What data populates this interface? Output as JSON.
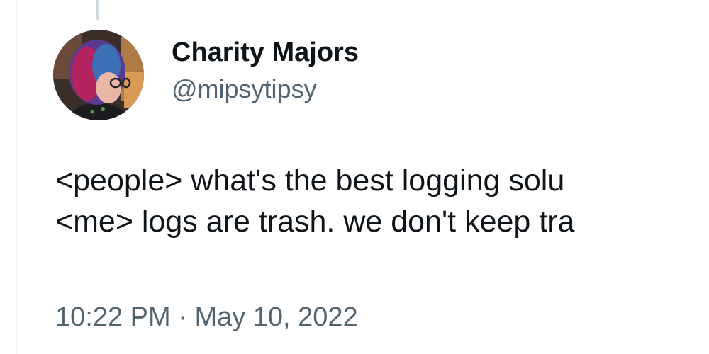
{
  "author": {
    "display_name": "Charity Majors",
    "handle": "@mipsytipsy"
  },
  "tweet": {
    "lines": [
      "<people> what's the best logging solu",
      "<me> logs are trash. we don't keep tra"
    ]
  },
  "meta": {
    "time": "10:22 PM",
    "separator": "·",
    "date": "May 10, 2022"
  },
  "colors": {
    "text_primary": "#0f1419",
    "text_secondary": "#536471",
    "thread_line": "#cfd9de"
  }
}
